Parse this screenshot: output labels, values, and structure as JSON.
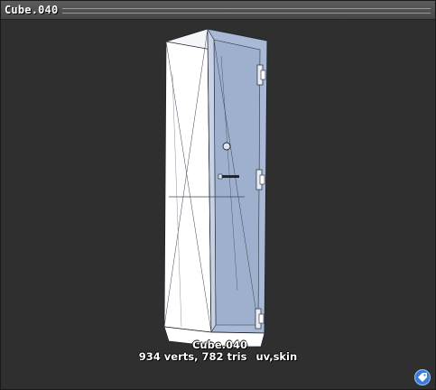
{
  "window": {
    "title": "Cube.040"
  },
  "viewport": {
    "model_name": "Cube.040",
    "vertex_count": "934 verts,",
    "tri_count": "782 tris",
    "attributes": "uv,skin",
    "icons": {
      "tag_button": "tag-icon"
    }
  },
  "colors": {
    "background": "#2f2f2f",
    "model_front": "#a9b8d4",
    "model_side": "#ffffff",
    "wire": "#1e2530",
    "tag_button": "#3a7bd5"
  }
}
